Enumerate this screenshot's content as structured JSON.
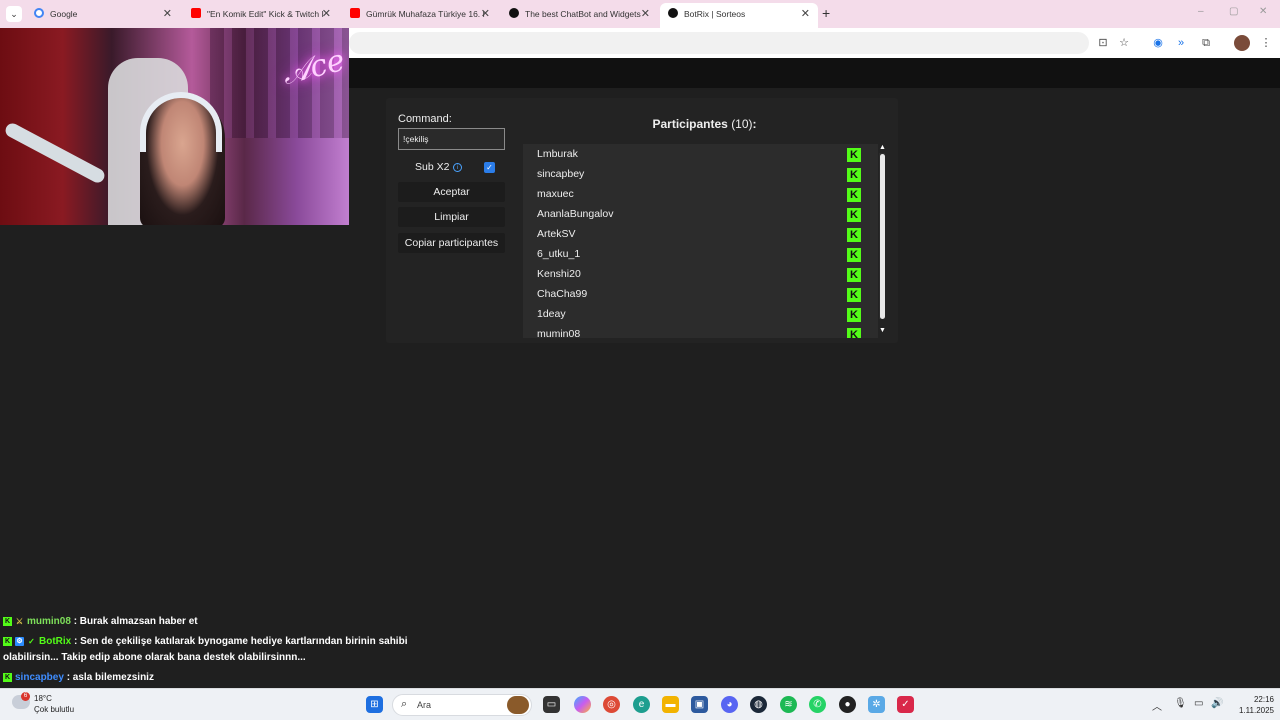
{
  "browser": {
    "tabs": [
      {
        "title": "Google",
        "color": "#4285f4"
      },
      {
        "title": "\"En Komik Edit\" Kick & Twitch I",
        "color": "#ff0000"
      },
      {
        "title": "Gümrük Muhafaza Türkiye 16. I",
        "color": "#ff0000"
      },
      {
        "title": "The best ChatBot and Widgets",
        "color": "#111111"
      },
      {
        "title": "BotRix | Sorteos",
        "color": "#111111",
        "active": true
      }
    ],
    "newtab": "+",
    "window_controls": [
      "–",
      "▢",
      "✕"
    ]
  },
  "panel": {
    "command_label": "Command:",
    "command_value": "!çekiliş",
    "sub_label": "Sub X2",
    "sub_checked": true,
    "buttons": {
      "accept": "Aceptar",
      "clear": "Limpiar",
      "copy": "Copiar participantes"
    },
    "participants_title": "Participantes",
    "participants_count": "(10)",
    "participants_colon": ":",
    "participants": [
      "Lmburak",
      "sincapbey",
      "maxuec",
      "AnanlaBungalov",
      "ArtekSV",
      "6_utku_1",
      "Kenshi20",
      "ChaCha99",
      "1deay",
      "mumin08"
    ]
  },
  "chat": [
    {
      "user": "mumin08",
      "user_color": "#7ee05a",
      "message": ": Burak almazsan haber et"
    },
    {
      "user": "BotRix",
      "user_color": "#53fc18",
      "message": ": Sen de çekilişe katılarak bynogame hediye kartlarından birinin sahibi",
      "cont": "olabilirsin... Takip edip abone olarak bana destek olabilirsinnn..."
    },
    {
      "user": "sincapbey",
      "user_color": "#3f8dff",
      "message": ": asla bilemezsiniz"
    }
  ],
  "taskbar": {
    "weather_badge": "6",
    "temperature": "18°C",
    "condition": "Çok bulutlu",
    "search_placeholder": "Ara",
    "time": "22:16",
    "date": "1.11.2025"
  }
}
